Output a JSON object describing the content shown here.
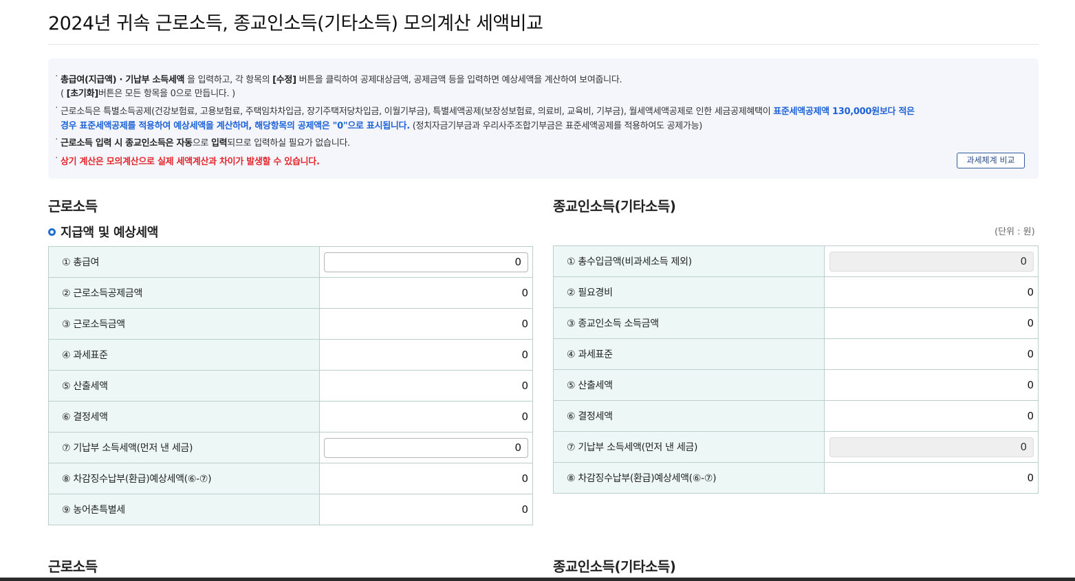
{
  "page_title": "2024년 귀속 근로소득, 종교인소득(기타소득) 모의계산 세액비교",
  "notice": {
    "line1_bold": "총급여(지급액) · 기납부 소득세액",
    "line1_rest_a": " 을 입력하고, 각 항목의 ",
    "line1_bold2": "[수정]",
    "line1_rest_b": " 버튼을 클릭하여 공제대상금액, 공제금액 등을 입력하면 예상세액을 계산하여 보여줍니다.",
    "line2_a": "( ",
    "line2_bold": "[초기화]",
    "line2_b": "버튼은 모든 항목을 0으로 만듭니다. )",
    "line3_a": "근로소득은 특별소득공제(건강보험료, 고용보험료, 주택임차차입금, 장기주택저당차입금, 이월기부금), 특별세액공제(보장성보험료, 의료비, 교육비, 기부금), 월세액세액공제로 인한 세금공제혜택이 ",
    "line3_blue": "표준세액공제액 130,000원보다 적은",
    "line4_blue": "경우 표준세액공제를 적용하여 예상세액을 계산하며, 해당항목의 공제액은 \"0\"으로 표시됩니다.",
    "line4_rest": " (정치자금기부금과 우리사주조합기부금은 표준세액공제를 적용하여도 공제가능)",
    "line5_bold_a": "근로소득 입력 시 종교인소득은 ",
    "line5_bold_b": "자동",
    "line5_mid": "으로 ",
    "line5_bold_c": "입력",
    "line5_rest": "되므로 입력하실 필요가 없습니다.",
    "line6_red": "상기 계산은 모의계산으로 실제 세액계산과 차이가 발생할 수 있습니다.",
    "compare_button": "과세체계 비교"
  },
  "left": {
    "section_title": "근로소득",
    "sub_title": "지급액 및 예상세액",
    "rows": [
      {
        "label": "① 총급여",
        "value": "0"
      },
      {
        "label": "② 근로소득공제금액",
        "value": "0"
      },
      {
        "label": "③ 근로소득금액",
        "value": "0"
      },
      {
        "label": "④ 과세표준",
        "value": "0"
      },
      {
        "label": "⑤ 산출세액",
        "value": "0"
      },
      {
        "label": "⑥ 결정세액",
        "value": "0"
      },
      {
        "label": "⑦ 기납부 소득세액(먼저 낸 세금)",
        "value": "0"
      },
      {
        "label": "⑧ 차감징수납부(환급)예상세액(⑥-⑦)",
        "value": "0"
      },
      {
        "label": "⑨ 농어촌특별세",
        "value": "0"
      }
    ]
  },
  "right": {
    "section_title": "종교인소득(기타소득)",
    "unit": "(단위 : 원)",
    "rows": [
      {
        "label": "① 총수입금액(비과세소득 제외)",
        "value": "0"
      },
      {
        "label": "② 필요경비",
        "value": "0"
      },
      {
        "label": "③ 종교인소득 소득금액",
        "value": "0"
      },
      {
        "label": "④ 과세표준",
        "value": "0"
      },
      {
        "label": "⑤ 산출세액",
        "value": "0"
      },
      {
        "label": "⑥ 결정세액",
        "value": "0"
      },
      {
        "label": "⑦ 기납부 소득세액(먼저 낸 세금)",
        "value": "0"
      },
      {
        "label": "⑧ 차감징수납부(환급)예상세액(⑥-⑦)",
        "value": "0"
      }
    ]
  },
  "bottom": {
    "left_title": "근로소득",
    "right_title": "종교인소득(기타소득)"
  }
}
